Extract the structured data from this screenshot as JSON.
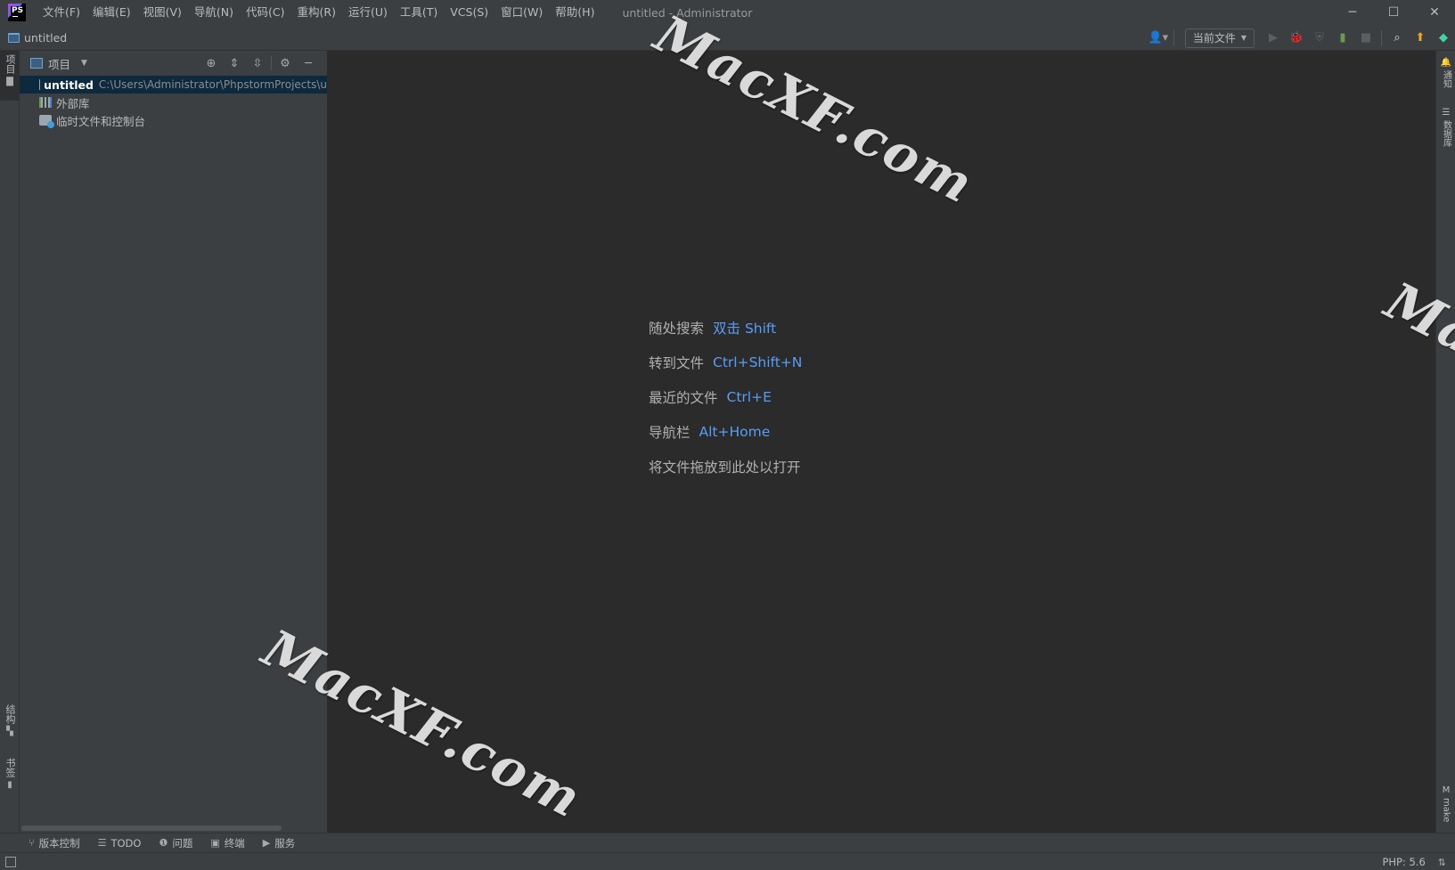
{
  "titlebar": {
    "logo_text": "PS",
    "menu": [
      "文件(F)",
      "编辑(E)",
      "视图(V)",
      "导航(N)",
      "代码(C)",
      "重构(R)",
      "运行(U)",
      "工具(T)",
      "VCS(S)",
      "窗口(W)",
      "帮助(H)"
    ],
    "window_title": "untitled - Administrator",
    "controls": {
      "minimize": "─",
      "maximize": "☐",
      "close": "✕"
    }
  },
  "navbar": {
    "breadcrumb": "untitled",
    "run_config": "当前文件",
    "icons": [
      "user-icon",
      "run-icon",
      "debug-icon",
      "coverage-icon",
      "profile-icon",
      "stop-icon",
      "search-icon",
      "update-icon",
      "jetbrains-icon"
    ]
  },
  "left_strip": {
    "top_tab": "项目",
    "bottom_tabs": [
      "结构",
      "书签"
    ]
  },
  "project_panel": {
    "title": "项目",
    "tree": [
      {
        "name": "untitled",
        "path": "C:\\Users\\Administrator\\PhpstormProjects\\u",
        "icon": "folder-icon"
      },
      {
        "name": "外部库",
        "icon": "library-icon"
      },
      {
        "name": "临时文件和控制台",
        "icon": "scratch-icon"
      }
    ]
  },
  "editor": {
    "hints": [
      {
        "label": "随处搜索",
        "key": "双击 Shift"
      },
      {
        "label": "转到文件",
        "key": "Ctrl+Shift+N"
      },
      {
        "label": "最近的文件",
        "key": "Ctrl+E"
      },
      {
        "label": "导航栏",
        "key": "Alt+Home"
      },
      {
        "label": "将文件拖放到此处以打开",
        "key": ""
      }
    ]
  },
  "right_strip": {
    "tabs": [
      "通知",
      "数据库",
      "make"
    ]
  },
  "bottom_bar": {
    "tabs": [
      {
        "label": "版本控制",
        "icon": "branch-icon"
      },
      {
        "label": "TODO",
        "icon": "list-icon"
      },
      {
        "label": "问题",
        "icon": "info-icon"
      },
      {
        "label": "终端",
        "icon": "terminal-icon"
      },
      {
        "label": "服务",
        "icon": "play-circle-icon"
      }
    ]
  },
  "status_bar": {
    "php_version": "PHP: 5.6"
  },
  "watermark": "MacXF.com",
  "colors": {
    "background": "#2b2b2b",
    "panel": "#3c3f41",
    "selection": "#0d293e",
    "link": "#589df6"
  }
}
